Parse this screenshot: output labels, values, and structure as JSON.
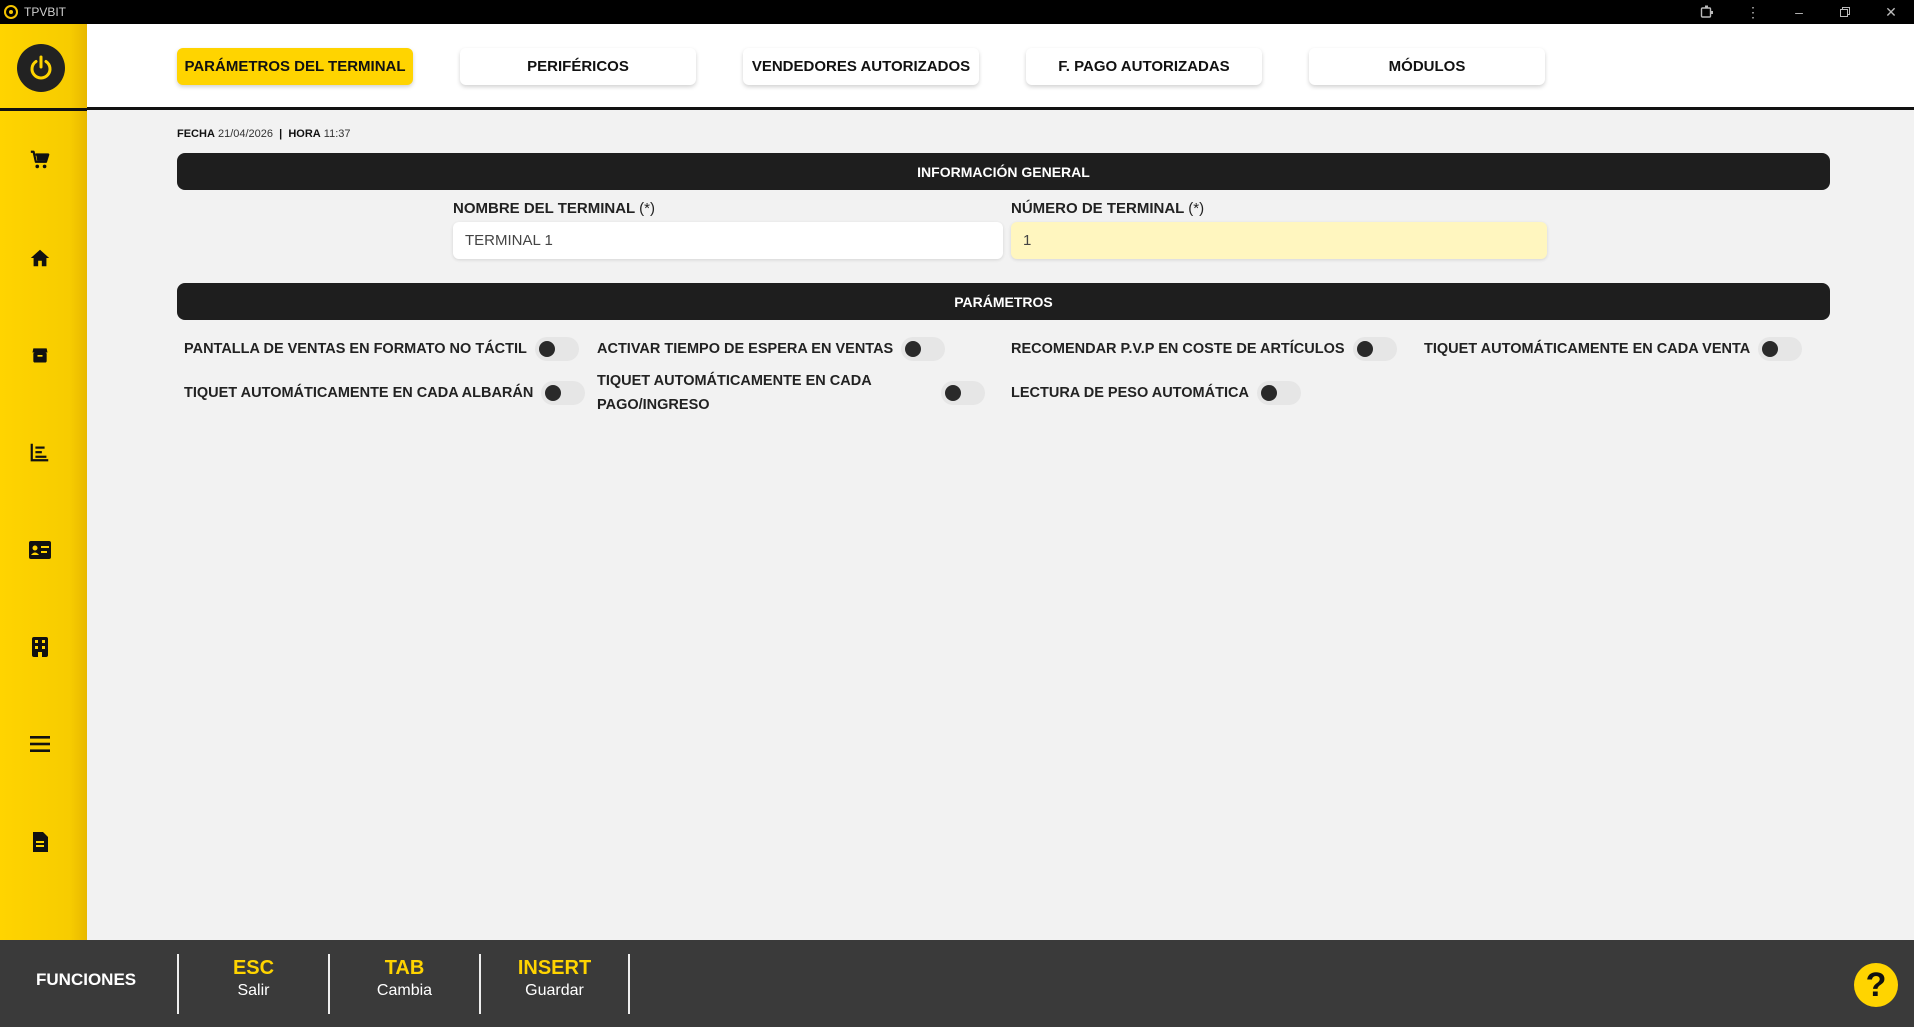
{
  "window": {
    "title": "TPVBIT"
  },
  "tabs": [
    {
      "label": "PARÁMETROS DEL TERMINAL",
      "active": true
    },
    {
      "label": "PERIFÉRICOS",
      "active": false
    },
    {
      "label": "VENDEDORES AUTORIZADOS",
      "active": false
    },
    {
      "label": "F. PAGO AUTORIZADAS",
      "active": false
    },
    {
      "label": "MÓDULOS",
      "active": false
    }
  ],
  "datetime": {
    "date_label": "FECHA",
    "date_value": "21/04/2026",
    "separator": "|",
    "time_label": "HORA",
    "time_value": "11:37"
  },
  "general": {
    "title": "INFORMACIÓN GENERAL",
    "terminal_name": {
      "label": "NOMBRE DEL TERMINAL",
      "required": "(*)",
      "value": "TERMINAL 1"
    },
    "terminal_number": {
      "label": "NÚMERO DE TERMINAL",
      "required": "(*)",
      "value": "1"
    }
  },
  "parameters": {
    "title": "PARÁMETROS",
    "items": [
      {
        "label": "PANTALLA DE VENTAS EN FORMATO NO TÁCTIL",
        "enabled": false
      },
      {
        "label": "ACTIVAR TIEMPO DE ESPERA EN VENTAS",
        "enabled": false
      },
      {
        "label": "RECOMENDAR P.V.P EN COSTE DE ARTÍCULOS",
        "enabled": false
      },
      {
        "label": "TIQUET AUTOMÁTICAMENTE EN CADA VENTA",
        "enabled": false
      },
      {
        "label": "TIQUET AUTOMÁTICAMENTE EN CADA ALBARÁN",
        "enabled": false
      },
      {
        "label": "TIQUET AUTOMÁTICAMENTE EN CADA PAGO/INGRESO",
        "enabled": false
      },
      {
        "label": "LECTURA DE PESO AUTOMÁTICA",
        "enabled": false
      }
    ]
  },
  "sidebar": {
    "icons": [
      "cart-icon",
      "home-icon",
      "box-icon",
      "chart-icon",
      "id-card-icon",
      "building-icon",
      "menu-icon",
      "document-icon"
    ]
  },
  "footer": {
    "title": "FUNCIONES",
    "keys": [
      {
        "key": "ESC",
        "desc": "Salir"
      },
      {
        "key": "TAB",
        "desc": "Cambia"
      },
      {
        "key": "INSERT",
        "desc": "Guardar"
      }
    ],
    "help": "?"
  },
  "colors": {
    "accent": "#ffd400",
    "dark": "#1e1e1e",
    "footer": "#3a3a3a",
    "highlight": "#fff6bf"
  }
}
